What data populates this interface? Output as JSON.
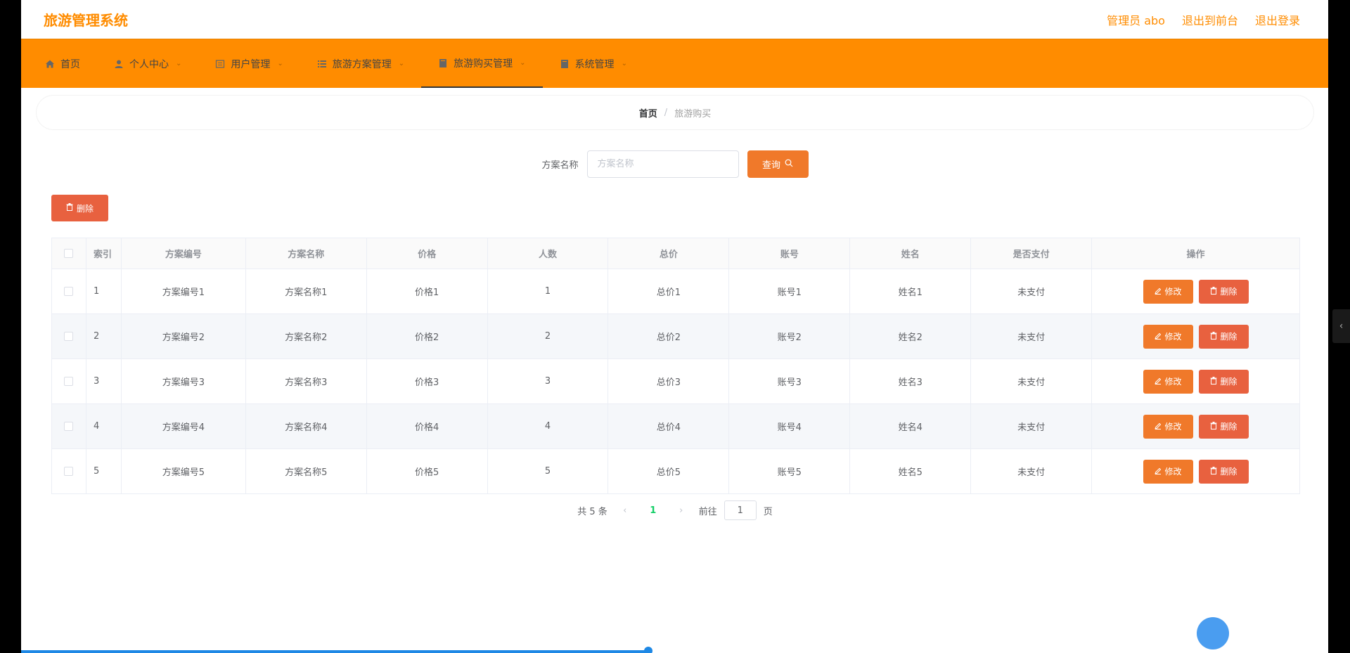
{
  "header": {
    "title": "旅游管理系统",
    "admin": "管理员 abo",
    "to_front": "退出到前台",
    "logout": "退出登录"
  },
  "nav": {
    "items": [
      {
        "label": "首页",
        "icon": "home-icon",
        "has_arrow": false
      },
      {
        "label": "个人中心",
        "icon": "user-icon",
        "has_arrow": true
      },
      {
        "label": "用户管理",
        "icon": "list-icon",
        "has_arrow": true
      },
      {
        "label": "旅游方案管理",
        "icon": "menu-icon",
        "has_arrow": true
      },
      {
        "label": "旅游购买管理",
        "icon": "document-icon",
        "has_arrow": true,
        "active": true
      },
      {
        "label": "系统管理",
        "icon": "document-icon",
        "has_arrow": true
      }
    ]
  },
  "breadcrumb": {
    "home": "首页",
    "sep": "/",
    "current": "旅游购买"
  },
  "search": {
    "label": "方案名称",
    "placeholder": "方案名称",
    "query_label": "查询"
  },
  "toolbar": {
    "delete_label": "删除"
  },
  "table": {
    "headers": [
      "索引",
      "方案编号",
      "方案名称",
      "价格",
      "人数",
      "总价",
      "账号",
      "姓名",
      "是否支付",
      "操作"
    ],
    "rows": [
      {
        "idx": "1",
        "code": "方案编号1",
        "name": "方案名称1",
        "price": "价格1",
        "count": "1",
        "total": "总价1",
        "account": "账号1",
        "person": "姓名1",
        "paid": "未支付"
      },
      {
        "idx": "2",
        "code": "方案编号2",
        "name": "方案名称2",
        "price": "价格2",
        "count": "2",
        "total": "总价2",
        "account": "账号2",
        "person": "姓名2",
        "paid": "未支付"
      },
      {
        "idx": "3",
        "code": "方案编号3",
        "name": "方案名称3",
        "price": "价格3",
        "count": "3",
        "total": "总价3",
        "account": "账号3",
        "person": "姓名3",
        "paid": "未支付"
      },
      {
        "idx": "4",
        "code": "方案编号4",
        "name": "方案名称4",
        "price": "价格4",
        "count": "4",
        "total": "总价4",
        "account": "账号4",
        "person": "姓名4",
        "paid": "未支付"
      },
      {
        "idx": "5",
        "code": "方案编号5",
        "name": "方案名称5",
        "price": "价格5",
        "count": "5",
        "total": "总价5",
        "account": "账号5",
        "person": "姓名5",
        "paid": "未支付"
      }
    ],
    "edit_label": "修改",
    "delete_label": "删除"
  },
  "pagination": {
    "total": "共 5 条",
    "current": "1",
    "goto_prefix": "前往",
    "goto_value": "1",
    "goto_suffix": "页"
  },
  "colors": {
    "accent": "#ff8c00",
    "query_button": "#f0792a",
    "danger_button": "#e8613f",
    "active_page": "#13ce66"
  }
}
